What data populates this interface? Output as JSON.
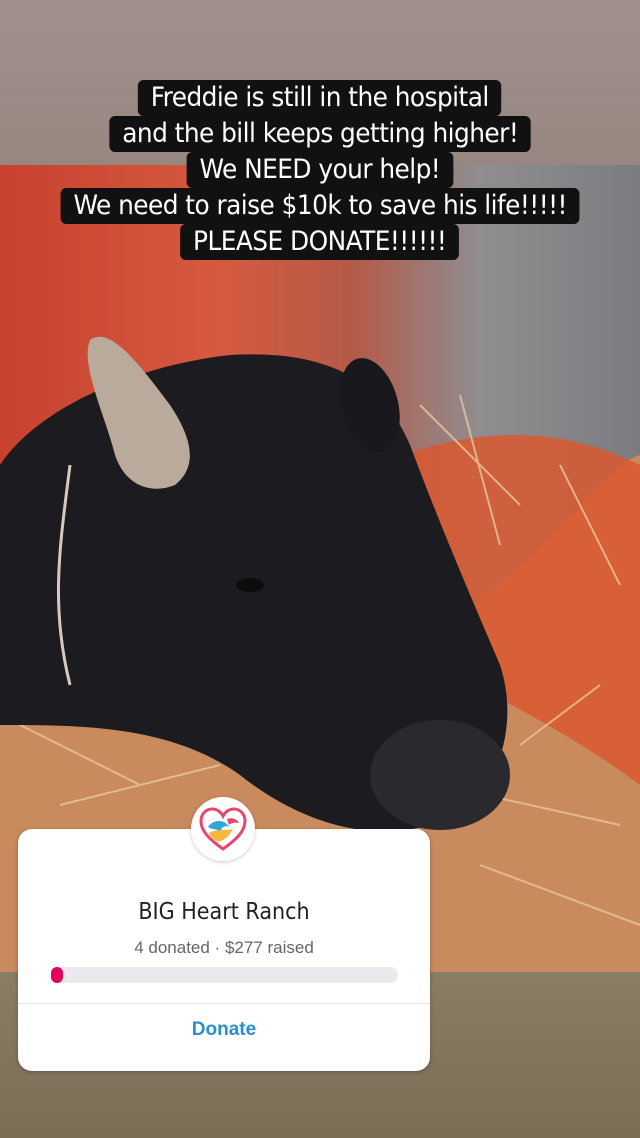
{
  "story": {
    "caption_lines": [
      "Freddie is still in the hospital",
      "and the bill keeps getting higher!",
      "We NEED your help!",
      "We need to raise $10k to save his life!!!!!",
      "PLEASE DONATE!!!!!!"
    ]
  },
  "fundraiser": {
    "org_name": "BIG Heart Ranch",
    "stats": "4 donated · $277 raised",
    "progress_fraction": 0.028,
    "donate_label": "Donate",
    "accent_color": "#e6005c",
    "button_color": "#2a8fd0",
    "logo_icon": "heart-wave-logo"
  }
}
